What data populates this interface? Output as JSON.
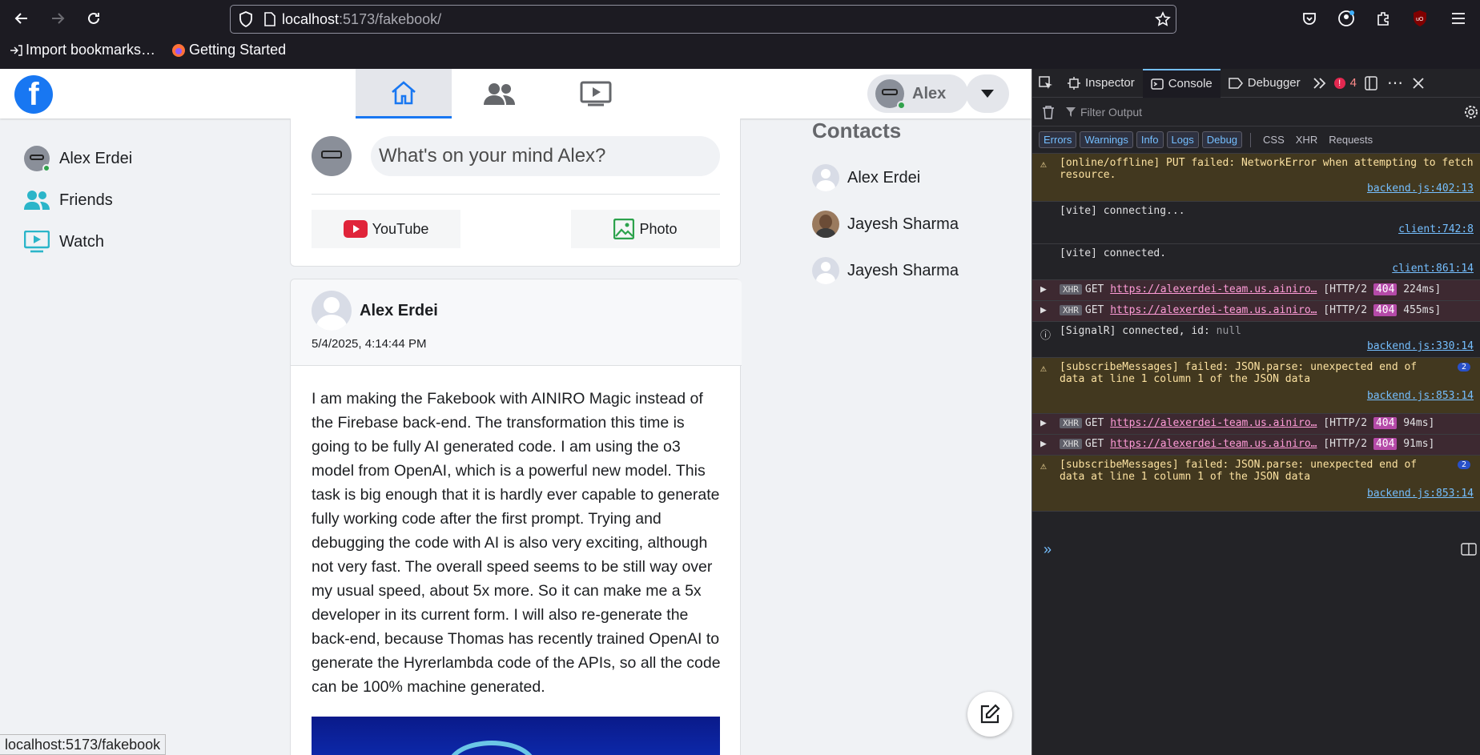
{
  "browser": {
    "url_host": "localhost",
    "url_path": ":5173/fakebook/",
    "bookmarks": [
      "Import bookmarks…",
      "Getting Started"
    ]
  },
  "fb": {
    "profile_name": "Alex",
    "left_nav": [
      "Alex Erdei",
      "Friends",
      "Watch"
    ],
    "composer_placeholder": "What's on your mind Alex?",
    "youtube_label": "YouTube",
    "photo_label": "Photo",
    "post": {
      "author": "Alex Erdei",
      "time": "5/4/2025, 4:14:44 PM",
      "text": "I am making the Fakebook with AINIRO Magic instead of the Firebase back-end. The transformation this time is going to be fully AI generated code. I am using the o3 model from OpenAI, which is a powerful new model. This task is big enough that it is hardly ever capable to generate fully working code after the first prompt. Trying and debugging the code with AI is also very exciting, although not very fast. The overall speed seems to be still way over my usual speed, about 5x more. So it can make me a 5x developer in its current form. I will also re-generate the back-end, because Thomas has recently trained OpenAI to generate the Hyrerlambda code of the APIs, so all the code can be 100% machine generated."
    },
    "contacts_title": "Contacts",
    "contacts": [
      "Alex Erdei",
      "Jayesh Sharma",
      "Jayesh Sharma"
    ],
    "status_url": "localhost:5173/fakebook"
  },
  "devtools": {
    "tabs": [
      "Inspector",
      "Console",
      "Debugger"
    ],
    "error_count": "4",
    "filter_placeholder": "Filter Output",
    "levels": [
      "Errors",
      "Warnings",
      "Info",
      "Logs",
      "Debug"
    ],
    "types": [
      "CSS",
      "XHR",
      "Requests"
    ],
    "entries": [
      {
        "msg": "[online/offline] PUT failed: NetworkError when attempting to fetch resource.",
        "src": "backend.js:402:13"
      },
      {
        "msg": "[vite] connecting...",
        "src": "client:742:8"
      },
      {
        "msg": "[vite] connected.",
        "src": "client:861:14"
      },
      {
        "url": "https://alexerdei-team.us.ainiro…",
        "status": "[HTTP/2",
        "code": "404",
        "time": "224ms]"
      },
      {
        "url": "https://alexerdei-team.us.ainiro…",
        "status": "[HTTP/2",
        "code": "404",
        "time": "455ms]"
      },
      {
        "msg": "[SignalR] connected, id: ",
        "null": "null",
        "src": "backend.js:330:14"
      },
      {
        "msg": "[subscribeMessages] failed: JSON.parse: unexpected end of data at line 1 column 1 of the JSON data",
        "src": "backend.js:853:14",
        "badge": "2"
      },
      {
        "url": "https://alexerdei-team.us.ainiro…",
        "status": "[HTTP/2",
        "code": "404",
        "time": "94ms]"
      },
      {
        "url": "https://alexerdei-team.us.ainiro…",
        "status": "[HTTP/2",
        "code": "404",
        "time": "91ms]"
      },
      {
        "msg": "[subscribeMessages] failed: JSON.parse: unexpected end of data at line 1 column 1 of the JSON data",
        "src": "backend.js:853:14",
        "badge": "2"
      }
    ],
    "get_label": "GET",
    "xhr_label": "XHR"
  }
}
